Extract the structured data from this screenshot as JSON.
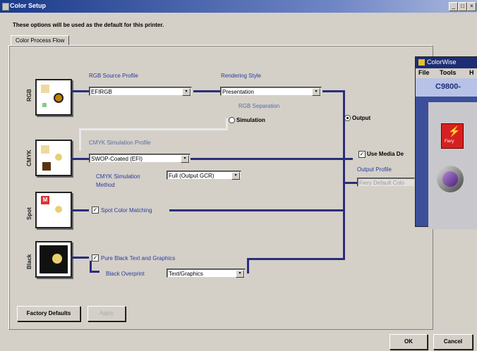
{
  "window": {
    "title": "Color Setup",
    "min": "_",
    "max": "□",
    "close": "×"
  },
  "intro_text": "These options will be used as the default for this printer.",
  "tab_label": "Color Process Flow",
  "rows": {
    "rgb": {
      "label": "RGB"
    },
    "cmyk": {
      "label": "CMYK"
    },
    "spot": {
      "label": "Spot"
    },
    "black": {
      "label": "Black"
    }
  },
  "rgb_source_profile": {
    "label": "RGB Source Profile",
    "value": "EFIRGB"
  },
  "rendering_style": {
    "label": "Rendering Style",
    "value": "Presentation"
  },
  "rgb_separation": {
    "label": "RGB Separation",
    "option_output": "Output",
    "option_simulation": "Simulation"
  },
  "cmyk_simulation_profile": {
    "label": "CMYK Simulation Profile",
    "value": "SWOP-Coated (EFI)"
  },
  "cmyk_simulation_method": {
    "label_line1": "CMYK Simulation",
    "label_line2": "Method",
    "value": "Full (Output GCR)"
  },
  "use_media_defined": {
    "label": "Use Media De"
  },
  "output_profile": {
    "label": "Output Profile",
    "value": "Fiery Default Colo"
  },
  "spot_color_matching": {
    "label": "Spot Color Matching",
    "check": "✓"
  },
  "pure_black": {
    "label": "Pure Black Text and Graphics",
    "check": "✓"
  },
  "black_overprint": {
    "label": "Black Overprint",
    "value": "Text/Graphics"
  },
  "buttons": {
    "factory_defaults": "Factory Defaults",
    "apply": "Apply",
    "ok": "OK",
    "cancel": "Cancel"
  },
  "colorwise": {
    "title": "ColorWise",
    "menu_file": "File",
    "menu_tools": "Tools",
    "menu_h": "H",
    "device": "C9800-",
    "fiery_label": "Fiery"
  },
  "colors": {
    "title_start": "#1a3a8a",
    "flow_line": "#2a2e7a",
    "accent_blue": "#2a3aa0",
    "dialog_bg": "#d4d0c8"
  },
  "icons": {
    "combo_arrow": "▾",
    "checkmark": "✓"
  }
}
